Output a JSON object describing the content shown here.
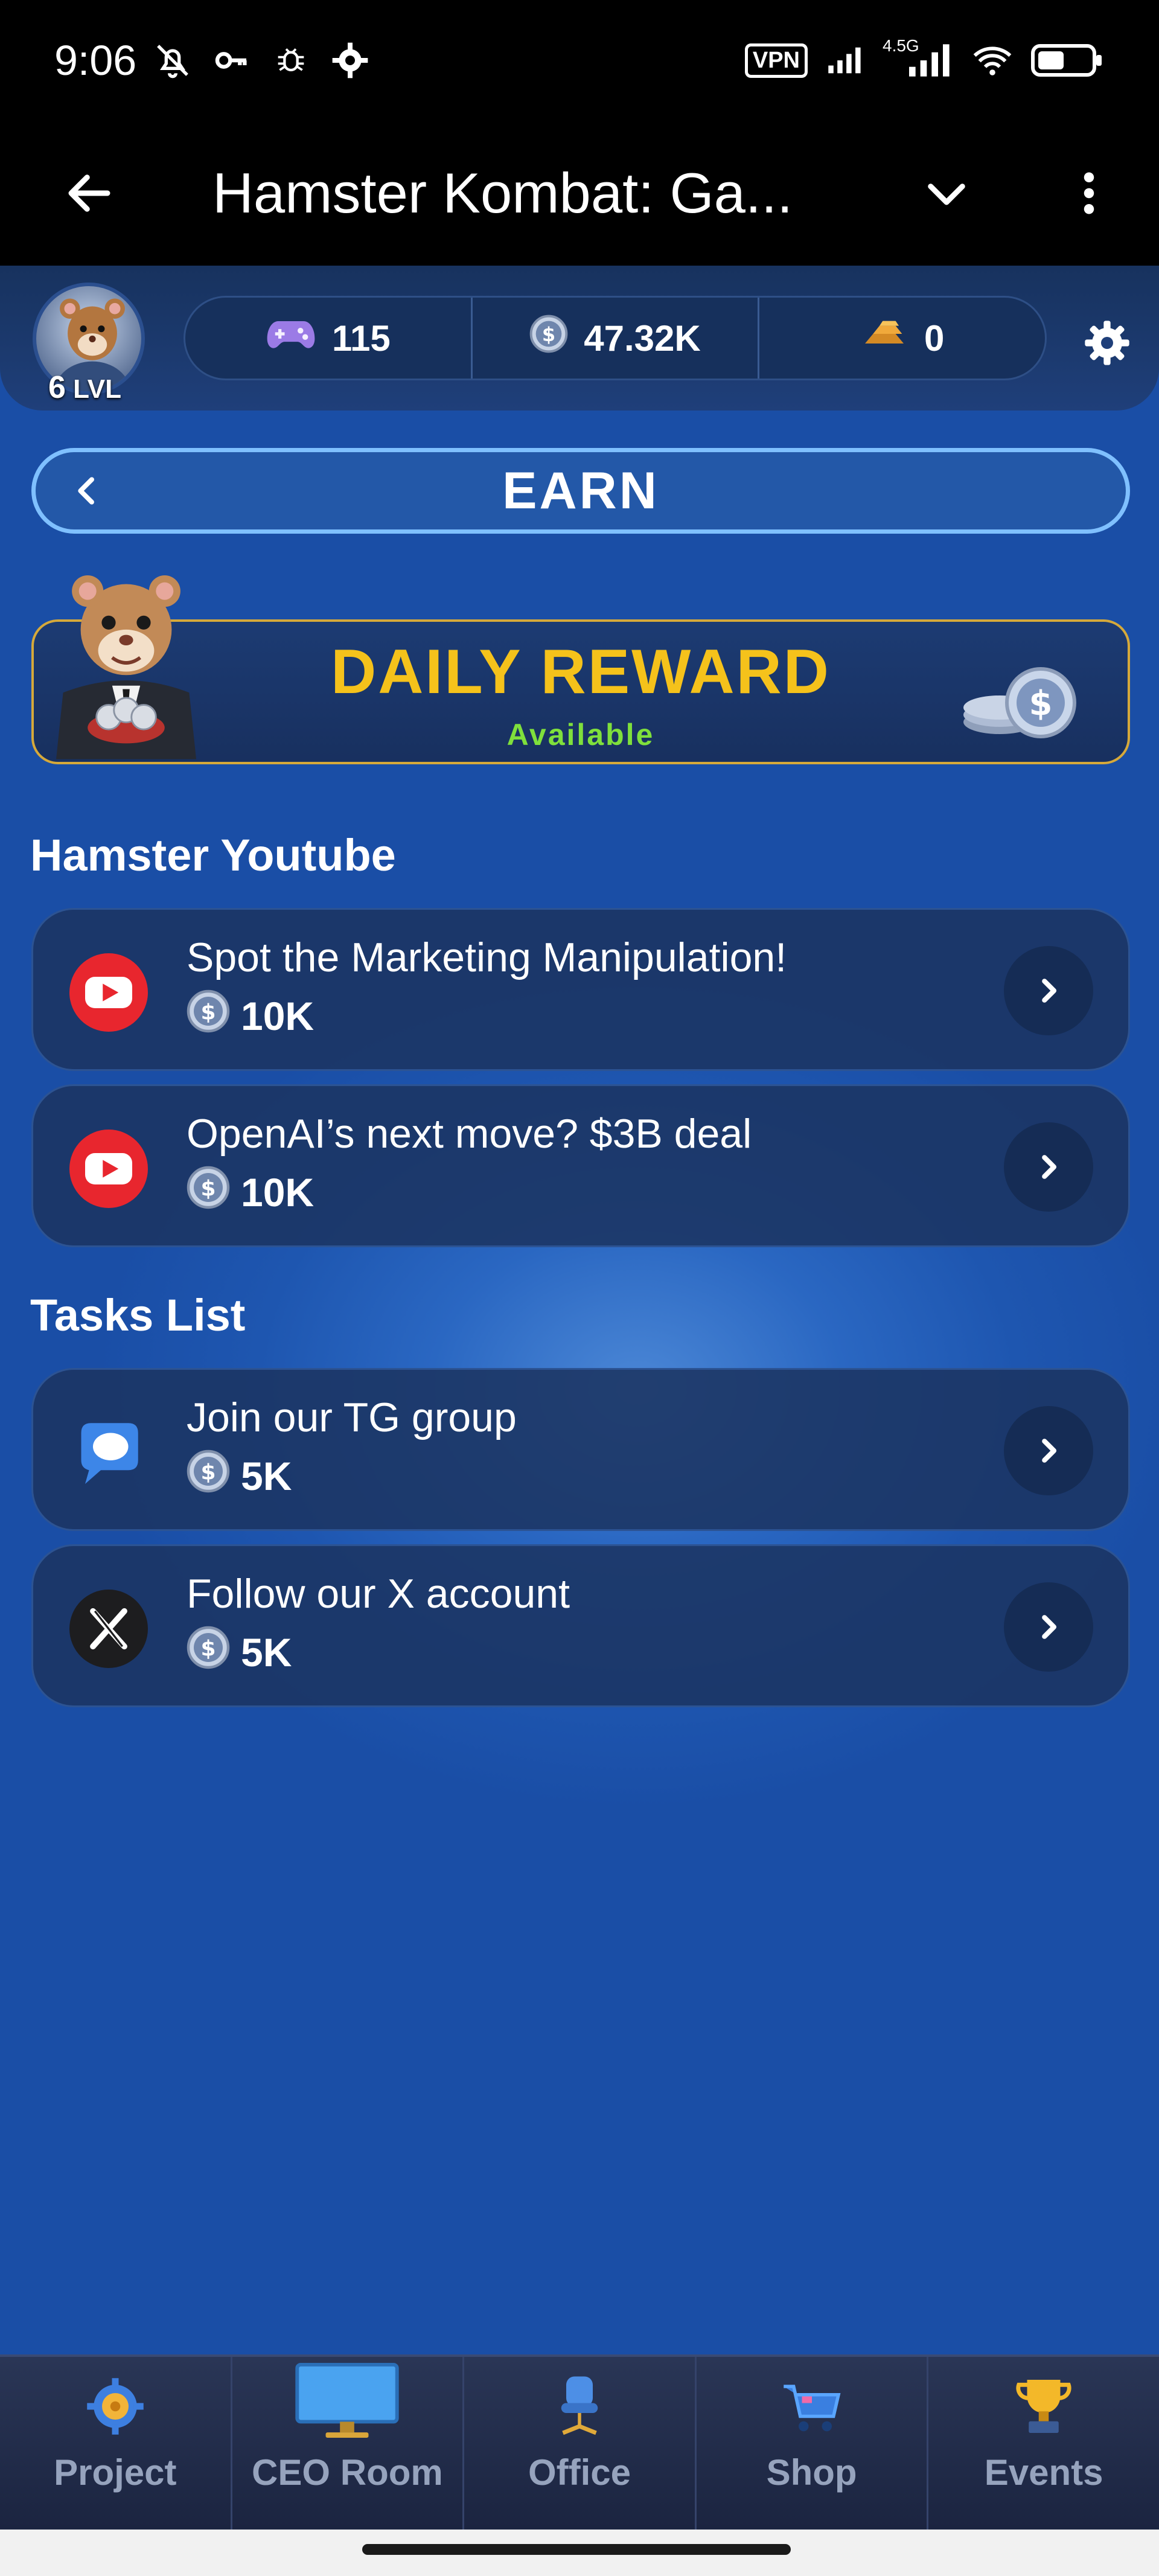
{
  "status_bar": {
    "time": "9:06",
    "left_icons": [
      "bell-off-icon",
      "key-icon",
      "bug-icon",
      "gear-icon"
    ],
    "right_icons": [
      "vpn-icon",
      "signal-icon",
      "signal-4-5g-icon",
      "wifi-icon",
      "battery-icon"
    ],
    "vpn_label": "VPN",
    "network_label": "4.5G"
  },
  "app_bar": {
    "title": "Hamster Kombat: Ga..."
  },
  "profile": {
    "level_number": "6",
    "level_suffix": "LVL"
  },
  "stats": {
    "games": "115",
    "coins": "47.32K",
    "gold": "0"
  },
  "earn": {
    "title": "EARN"
  },
  "daily_reward": {
    "title": "DAILY REWARD",
    "status": "Available"
  },
  "sections": {
    "youtube_title": "Hamster Youtube",
    "tasks_title": "Tasks List"
  },
  "youtube_tasks": [
    {
      "title": "Spot the Marketing Manipulation!",
      "reward": "10K"
    },
    {
      "title": "OpenAI’s next move? $3B deal",
      "reward": "10K"
    }
  ],
  "tasks": [
    {
      "title": "Join our TG group",
      "reward": "5K"
    },
    {
      "title": "Follow our X account",
      "reward": "5K"
    }
  ],
  "bottom_nav": [
    {
      "label": "Project",
      "icon": "project-icon"
    },
    {
      "label": "CEO Room",
      "icon": "monitor-icon"
    },
    {
      "label": "Office",
      "icon": "office-chair-icon"
    },
    {
      "label": "Shop",
      "icon": "cart-icon"
    },
    {
      "label": "Events",
      "icon": "trophy-icon"
    }
  ],
  "colors": {
    "accent_gold": "#f5c21b",
    "available_green": "#7fe03c",
    "earn_border": "#7fc0ff",
    "youtube_red": "#e8262e"
  }
}
